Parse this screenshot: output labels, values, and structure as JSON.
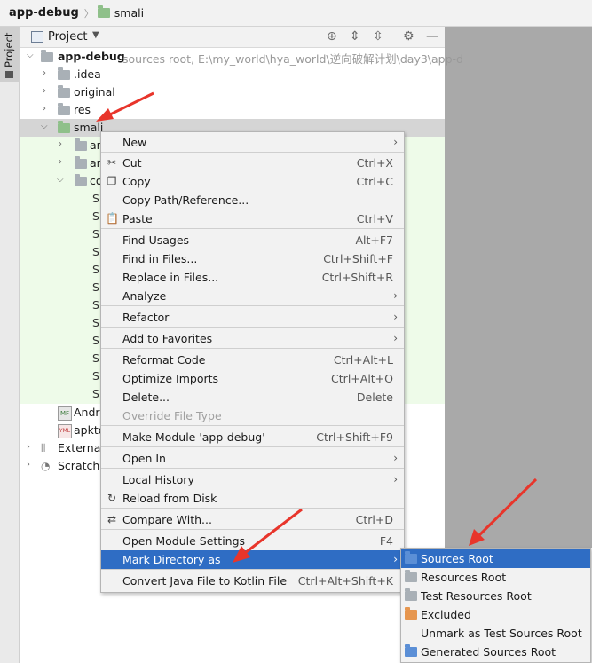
{
  "breadcrumb": {
    "root": "app-debug",
    "folder": "smali"
  },
  "toolstrip": {
    "tab_label": "Project"
  },
  "panel": {
    "title": "Project"
  },
  "tree": {
    "root": {
      "name": "app-debug",
      "hint": "sources root,  E:\\my_world\\hya_world\\逆向破解计划\\day3\\app-d"
    },
    "items": [
      {
        "name": ".idea"
      },
      {
        "name": "original"
      },
      {
        "name": "res"
      },
      {
        "name": "smali"
      },
      {
        "name": "ar"
      },
      {
        "name": "ar"
      },
      {
        "name": "co"
      }
    ],
    "files_prefix": "S",
    "android_manifest": "Andro",
    "apktool": "apkto",
    "external": "External",
    "scratches": "Scratche"
  },
  "context_menu": {
    "items": [
      {
        "label": "New",
        "shortcut": "",
        "submenu": true
      },
      {
        "label": "Cut",
        "shortcut": "Ctrl+X",
        "icon": "scissors-icon"
      },
      {
        "label": "Copy",
        "shortcut": "Ctrl+C",
        "icon": "copy-icon"
      },
      {
        "label": "Copy Path/Reference...",
        "shortcut": ""
      },
      {
        "label": "Paste",
        "shortcut": "Ctrl+V",
        "icon": "paste-icon"
      },
      {
        "label": "Find Usages",
        "shortcut": "Alt+F7"
      },
      {
        "label": "Find in Files...",
        "shortcut": "Ctrl+Shift+F"
      },
      {
        "label": "Replace in Files...",
        "shortcut": "Ctrl+Shift+R"
      },
      {
        "label": "Analyze",
        "shortcut": "",
        "submenu": true
      },
      {
        "label": "Refactor",
        "shortcut": "",
        "submenu": true
      },
      {
        "label": "Add to Favorites",
        "shortcut": "",
        "submenu": true
      },
      {
        "label": "Reformat Code",
        "shortcut": "Ctrl+Alt+L"
      },
      {
        "label": "Optimize Imports",
        "shortcut": "Ctrl+Alt+O"
      },
      {
        "label": "Delete...",
        "shortcut": "Delete"
      },
      {
        "label": "Override File Type",
        "shortcut": "",
        "disabled": true
      },
      {
        "label": "Make Module 'app-debug'",
        "shortcut": "Ctrl+Shift+F9"
      },
      {
        "label": "Open In",
        "shortcut": "",
        "submenu": true
      },
      {
        "label": "Local History",
        "shortcut": "",
        "submenu": true
      },
      {
        "label": "Reload from Disk",
        "shortcut": "",
        "icon": "reload-icon"
      },
      {
        "label": "Compare With...",
        "shortcut": "Ctrl+D",
        "icon": "compare-icon"
      },
      {
        "label": "Open Module Settings",
        "shortcut": "F4"
      },
      {
        "label": "Mark Directory as",
        "shortcut": "",
        "submenu": true,
        "active": true
      },
      {
        "label": "Convert Java File to Kotlin File",
        "shortcut": "Ctrl+Alt+Shift+K"
      }
    ]
  },
  "submenu": {
    "items": [
      {
        "label": "Sources Root",
        "icon": "sources-root-folder-icon",
        "active": true
      },
      {
        "label": "Resources Root",
        "icon": "resources-root-folder-icon"
      },
      {
        "label": "Test Resources Root",
        "icon": "test-resources-root-folder-icon"
      },
      {
        "label": "Excluded",
        "icon": "excluded-folder-icon"
      },
      {
        "label": "Unmark as Test Sources Root",
        "icon": ""
      },
      {
        "label": "Generated Sources Root",
        "icon": "generated-sources-root-folder-icon"
      }
    ]
  },
  "colors": {
    "accent": "#2f6dc4",
    "annotation": "#e8352b",
    "source_folder": "#8fc08a"
  }
}
